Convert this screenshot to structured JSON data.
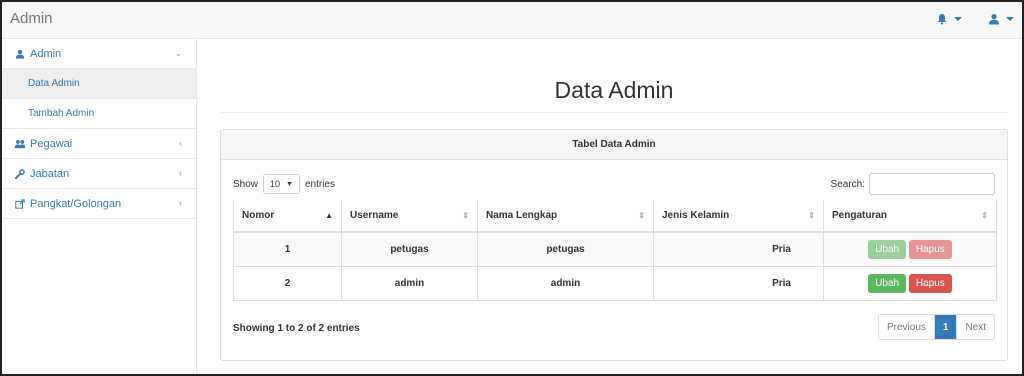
{
  "app": {
    "brand": "Admin"
  },
  "navbar": {
    "notifications_icon": "bell-icon",
    "user_icon": "user-icon",
    "accent_color": "#337ab7"
  },
  "sidebar": {
    "items": [
      {
        "label": "Admin",
        "icon": "user-icon",
        "expanded": true,
        "children": [
          {
            "label": "Data Admin",
            "active": true
          },
          {
            "label": "Tambah Admin",
            "active": false
          }
        ]
      },
      {
        "label": "Pegawai",
        "icon": "users-icon"
      },
      {
        "label": "Jabatan",
        "icon": "wrench-icon"
      },
      {
        "label": "Pangkat/Golongan",
        "icon": "external-link-icon"
      }
    ]
  },
  "main": {
    "title": "Data Admin",
    "panel_title": "Tabel Data Admin",
    "length_control": {
      "prefix": "Show",
      "value": "10",
      "suffix": "entries"
    },
    "search": {
      "label": "Search:",
      "value": "",
      "placeholder": ""
    },
    "table": {
      "columns": [
        "Nomor",
        "Username",
        "Nama Lengkap",
        "Jenis Kelamin",
        "Pengaturan"
      ],
      "rows": [
        {
          "nomor": "1",
          "username": "petugas",
          "nama_lengkap": "petugas",
          "jenis_kelamin": "Pria"
        },
        {
          "nomor": "2",
          "username": "admin",
          "nama_lengkap": "admin",
          "jenis_kelamin": "Pria"
        }
      ],
      "action_labels": {
        "edit": "Ubah",
        "delete": "Hapus"
      }
    },
    "info": "Showing 1 to 2 of 2 entries",
    "pagination": {
      "previous": "Previous",
      "current": "1",
      "next": "Next"
    }
  }
}
